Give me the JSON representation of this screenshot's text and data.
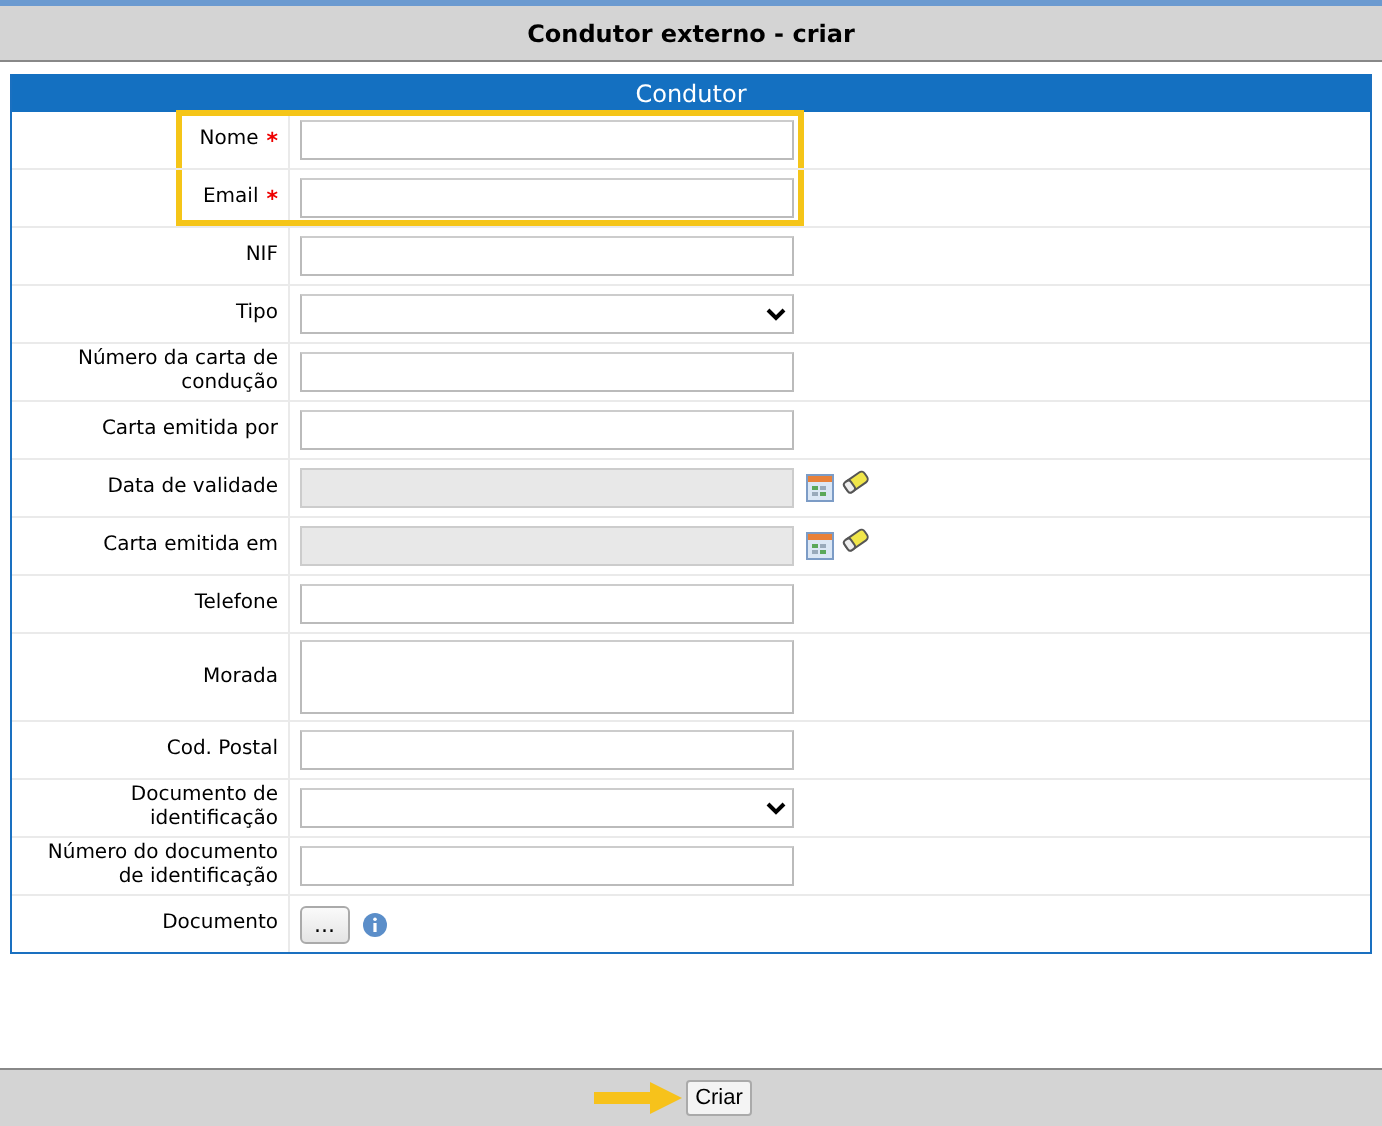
{
  "window": {
    "title": "Condutor externo - criar"
  },
  "section": {
    "title": "Condutor"
  },
  "fields": [
    {
      "label": "Nome",
      "kind": "text",
      "required": true,
      "highlighted": true
    },
    {
      "label": "Email",
      "kind": "text",
      "required": true,
      "highlighted": true
    },
    {
      "label": "NIF",
      "kind": "text",
      "required": false,
      "highlighted": false
    },
    {
      "label": "Tipo",
      "kind": "select",
      "required": false,
      "highlighted": false
    },
    {
      "label": "Número da carta de condução",
      "kind": "text",
      "required": false,
      "highlighted": false
    },
    {
      "label": "Carta emitida por",
      "kind": "text",
      "required": false,
      "highlighted": false
    },
    {
      "label": "Data de validade",
      "kind": "date",
      "required": false,
      "highlighted": false
    },
    {
      "label": "Carta emitida em",
      "kind": "date",
      "required": false,
      "highlighted": false
    },
    {
      "label": "Telefone",
      "kind": "text",
      "required": false,
      "highlighted": false
    },
    {
      "label": "Morada",
      "kind": "textarea",
      "required": false,
      "highlighted": false
    },
    {
      "label": "Cod. Postal",
      "kind": "text",
      "required": false,
      "highlighted": false
    },
    {
      "label": "Documento de identificação",
      "kind": "select",
      "required": false,
      "highlighted": false
    },
    {
      "label": "Número do documento de identificação",
      "kind": "text",
      "required": false,
      "highlighted": false
    },
    {
      "label": "Documento",
      "kind": "file",
      "required": false,
      "highlighted": false,
      "button": "..."
    }
  ],
  "required_mark": "*",
  "footer": {
    "button": "Criar",
    "arrow": true
  }
}
